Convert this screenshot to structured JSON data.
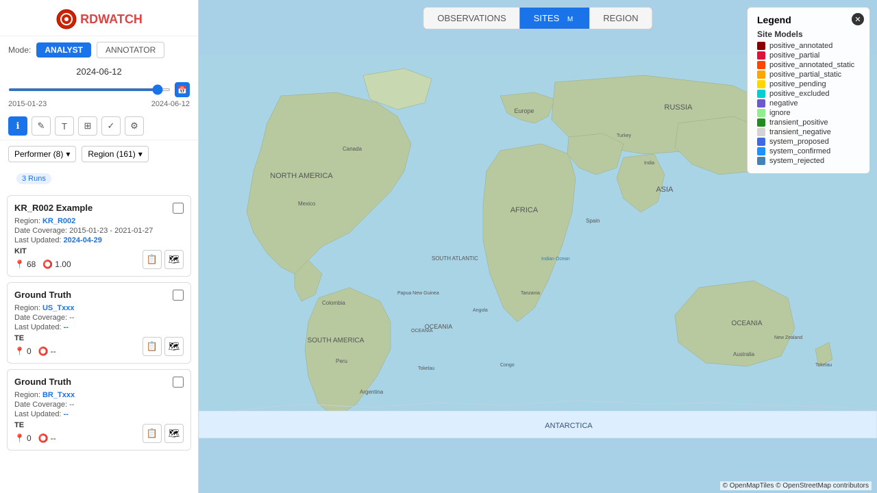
{
  "app": {
    "title": "RDWATCH",
    "logo_symbol": "🔴"
  },
  "mode": {
    "label": "Mode:",
    "analyst_label": "ANALYST",
    "annotator_label": "ANNOTATOR"
  },
  "timeline": {
    "current_date": "2024-06-12",
    "start_date": "2015-01-23",
    "end_date": "2024-06-12",
    "slider_value": 95
  },
  "toolbar": {
    "tools": [
      "ℹ",
      "✎",
      "T",
      "⊞",
      "✓",
      "⚙"
    ]
  },
  "filters": {
    "performer_label": "Performer (8)",
    "region_label": "Region (161)"
  },
  "runs_badge": "3 Runs",
  "cards": [
    {
      "id": "card1",
      "title": "KR_R002 Example",
      "region_label": "Region:",
      "region_value": "KR_R002",
      "date_coverage_label": "Date Coverage:",
      "date_coverage_value": "2015-01-23 - 2021-01-27",
      "last_updated_label": "Last Updated:",
      "last_updated_value": "2024-04-29",
      "tag": "KIT",
      "count": 68,
      "score": "1.00"
    },
    {
      "id": "card2",
      "title": "Ground Truth",
      "region_label": "Region:",
      "region_value": "US_Txxx",
      "date_coverage_label": "Date Coverage:",
      "date_coverage_value": "--",
      "last_updated_label": "Last Updated:",
      "last_updated_value": "--",
      "tag": "TE",
      "count": 0,
      "score": "--"
    },
    {
      "id": "card3",
      "title": "Ground Truth",
      "region_label": "Region:",
      "region_value": "BR_Txxx",
      "date_coverage_label": "Date Coverage:",
      "date_coverage_value": "--",
      "last_updated_label": "Last Updated:",
      "last_updated_value": "--",
      "tag": "TE",
      "count": 0,
      "score": "--"
    }
  ],
  "map_tabs": [
    {
      "id": "observations",
      "label": "OBSERVATIONS",
      "active": false
    },
    {
      "id": "sites",
      "label": "SITES",
      "badge": "M",
      "active": true
    },
    {
      "id": "region",
      "label": "REGION",
      "active": false
    }
  ],
  "legend": {
    "title": "Legend",
    "section": "Site Models",
    "items": [
      {
        "label": "positive_annotated",
        "color": "#8B0000"
      },
      {
        "label": "positive_partial",
        "color": "#DC143C"
      },
      {
        "label": "positive_annotated_static",
        "color": "#FF4500"
      },
      {
        "label": "positive_partial_static",
        "color": "#FFA500"
      },
      {
        "label": "positive_pending",
        "color": "#FFD700"
      },
      {
        "label": "positive_excluded",
        "color": "#00CED1"
      },
      {
        "label": "negative",
        "color": "#6A5ACD"
      },
      {
        "label": "ignore",
        "color": "#90EE90"
      },
      {
        "label": "transient_positive",
        "color": "#228B22"
      },
      {
        "label": "transient_negative",
        "color": "#D3D3D3"
      },
      {
        "label": "system_proposed",
        "color": "#4169E1"
      },
      {
        "label": "system_confirmed",
        "color": "#1E90FF"
      },
      {
        "label": "system_rejected",
        "color": "#4682B4"
      }
    ]
  },
  "map_credit": "© OpenMapTiles © OpenStreetMap contributors"
}
